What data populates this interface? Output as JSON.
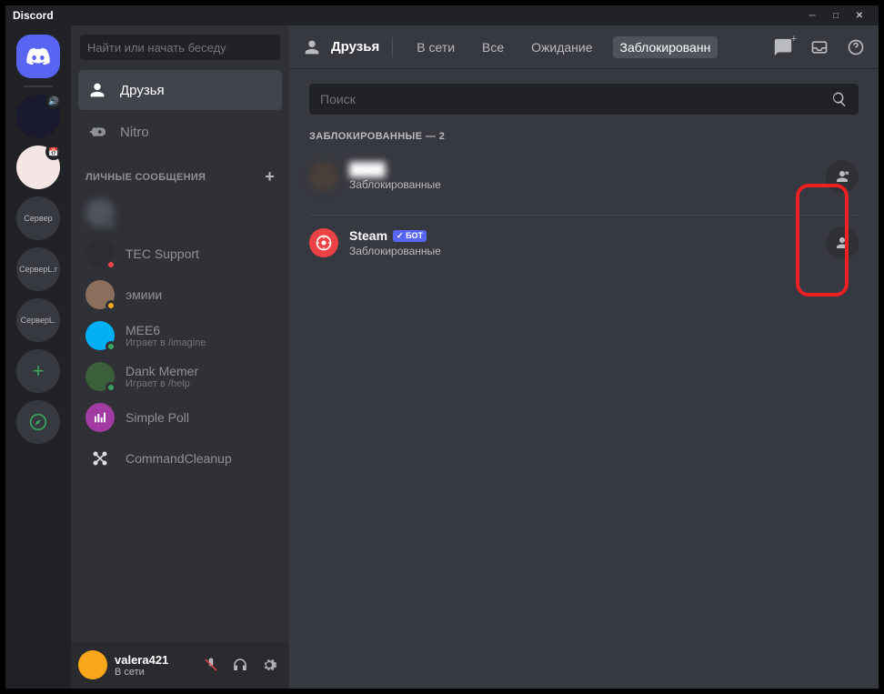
{
  "app_title": "Discord",
  "sidebar": {
    "search_placeholder": "Найти или начать беседу",
    "friends_label": "Друзья",
    "nitro_label": "Nitro",
    "dm_header": "ЛИЧНЫЕ СООБЩЕНИЯ",
    "dms": [
      {
        "name": "",
        "sub": "",
        "status": "off",
        "blurred": true,
        "av_color": "#4f545c"
      },
      {
        "name": "TEC Support",
        "sub": "",
        "status": "dnd",
        "av_color": "#2b2d31"
      },
      {
        "name": "эмиии",
        "sub": "",
        "status": "idle",
        "av_color": "#8b6f5c"
      },
      {
        "name": "MEE6",
        "sub": "Играет в /imagine",
        "status": "online",
        "av_color": "#00aff4"
      },
      {
        "name": "Dank Memer",
        "sub": "Играет в /help",
        "status": "online",
        "av_color": "#3a5f3a"
      },
      {
        "name": "Simple Poll",
        "sub": "",
        "status": "none",
        "av_color": "#a23ca2"
      },
      {
        "name": "CommandCleanup",
        "sub": "",
        "status": "none",
        "av_color": "#2f3136"
      }
    ]
  },
  "guilds": [
    {
      "type": "home"
    },
    {
      "type": "sep"
    },
    {
      "type": "img",
      "badge": "🔊",
      "bg": "#1a1a2e"
    },
    {
      "type": "img",
      "badge": "📅",
      "bg": "#f5e6e6"
    },
    {
      "type": "text",
      "label": "Сервер"
    },
    {
      "type": "text",
      "label": "СерверL.r"
    },
    {
      "type": "text",
      "label": "СерверL."
    },
    {
      "type": "add"
    },
    {
      "type": "compass"
    }
  ],
  "topbar": {
    "title": "Друзья",
    "tabs": [
      "В сети",
      "Все",
      "Ожидание",
      "Заблокированн"
    ],
    "active_tab": 3
  },
  "main": {
    "search_placeholder": "Поиск",
    "blocked_header": "ЗАБЛОКИРОВАННЫЕ — 2",
    "blocked": [
      {
        "name": "████",
        "sub": "Заблокированные",
        "blurred": true,
        "av_color": "#4a3f3a",
        "bot": false
      },
      {
        "name": "Steam",
        "sub": "Заблокированные",
        "blurred": false,
        "av_color": "#ed4245",
        "bot": true,
        "bot_label": "БОТ"
      }
    ]
  },
  "user": {
    "name": "valera421",
    "status": "В сети"
  }
}
